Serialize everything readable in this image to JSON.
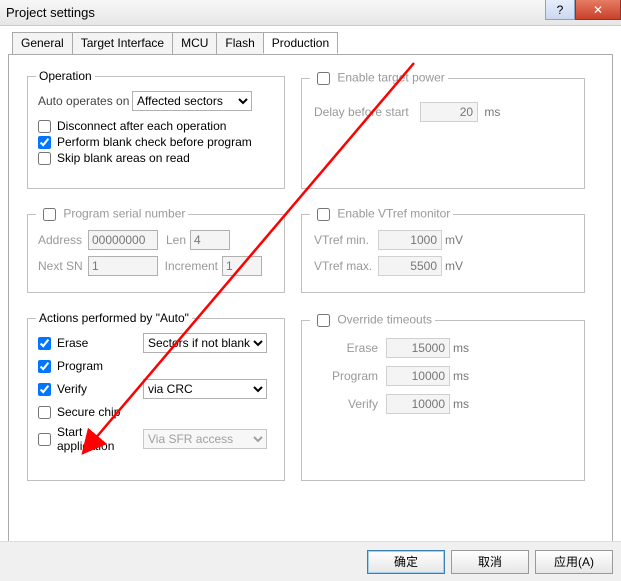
{
  "window": {
    "title": "Project settings",
    "help_btn": "?",
    "close_btn": "✕"
  },
  "tabs": [
    "General",
    "Target Interface",
    "MCU",
    "Flash",
    "Production"
  ],
  "active_tab": 4,
  "operation": {
    "legend": "Operation",
    "auto_label": "Auto operates on",
    "auto_value": "Affected sectors",
    "disconnect_label": "Disconnect after each operation",
    "blank_label": "Perform blank check before program",
    "skip_label": "Skip blank areas on read",
    "disconnect": false,
    "blank": true,
    "skip": false
  },
  "target_power": {
    "legend": "Enable target power",
    "enabled": false,
    "delay_label": "Delay before start",
    "delay_value": "20",
    "unit": "ms"
  },
  "serial": {
    "legend": "Program serial number",
    "enabled": false,
    "address_label": "Address",
    "address_value": "00000000",
    "len_label": "Len",
    "len_value": "4",
    "nextsn_label": "Next SN",
    "nextsn_value": "1",
    "inc_label": "Increment",
    "inc_value": "1"
  },
  "vtref": {
    "legend": "Enable VTref monitor",
    "enabled": false,
    "min_label": "VTref min.",
    "min_value": "1000",
    "max_label": "VTref max.",
    "max_value": "5500",
    "unit": "mV"
  },
  "actions": {
    "legend": "Actions performed by \"Auto\"",
    "erase_label": "Erase",
    "erase": true,
    "erase_mode": "Sectors if not blank",
    "program_label": "Program",
    "program": true,
    "verify_label": "Verify",
    "verify": true,
    "verify_mode": "via CRC",
    "secure_label": "Secure chip",
    "secure": false,
    "start_label": "Start application",
    "start": false,
    "start_mode": "Via SFR access"
  },
  "timeouts": {
    "legend": "Override timeouts",
    "enabled": false,
    "erase_label": "Erase",
    "erase_value": "15000",
    "program_label": "Program",
    "program_value": "10000",
    "verify_label": "Verify",
    "verify_value": "10000",
    "unit": "ms"
  },
  "buttons": {
    "ok": "确定",
    "cancel": "取消",
    "apply": "应用(A)"
  }
}
